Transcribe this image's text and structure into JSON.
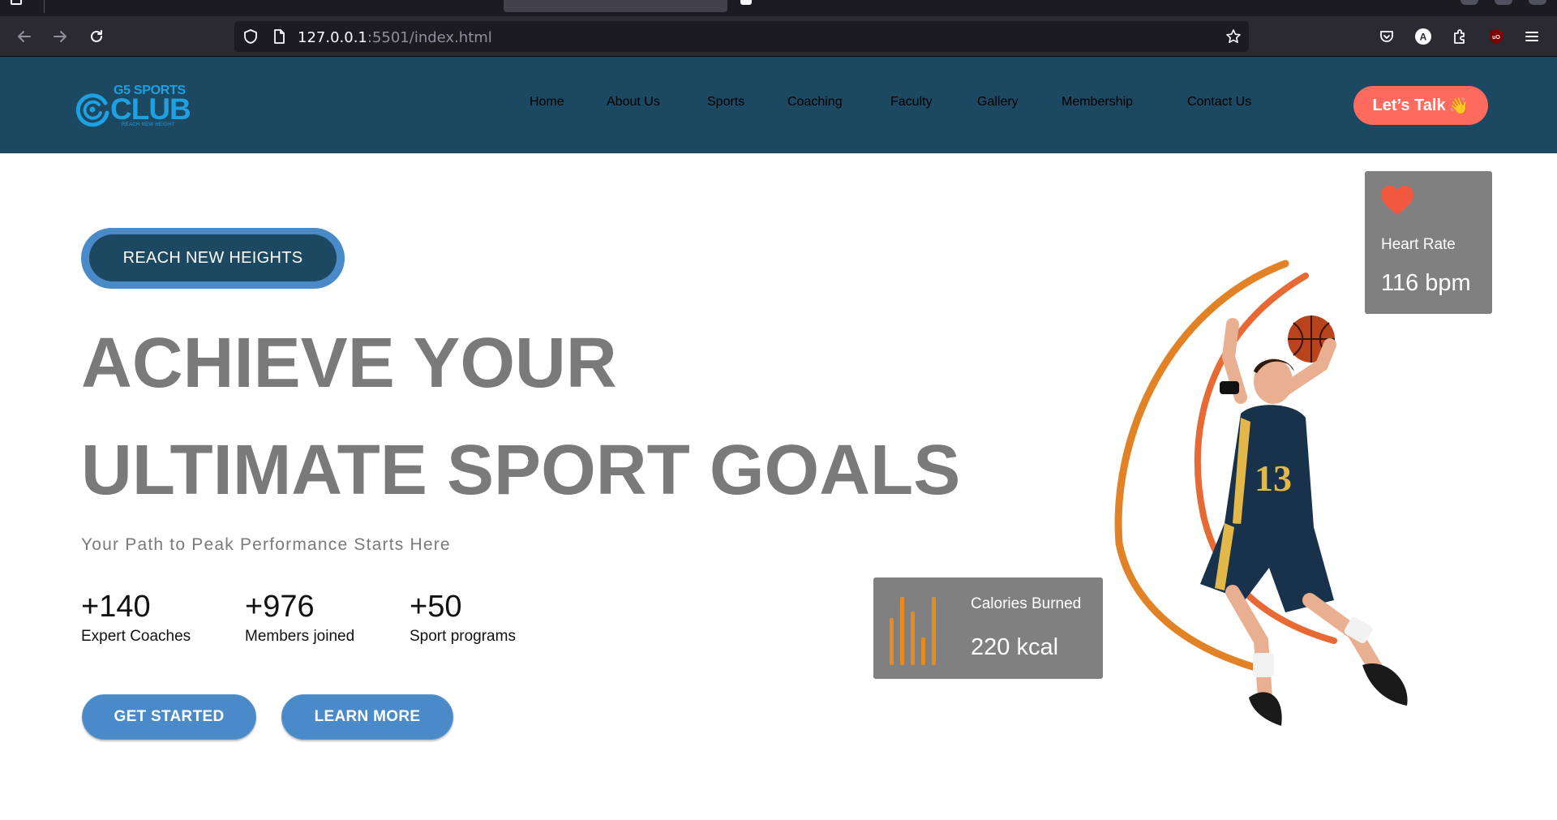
{
  "browser": {
    "url_host": "127.0.0.1",
    "url_path": ":5501/index.html"
  },
  "site": {
    "logo": {
      "top_text": "G5 SPORTS",
      "main_text": "CLUB",
      "tagline": "REACH NEW HEIGHT"
    },
    "nav": [
      "Home",
      "About Us",
      "Sports",
      "Coaching",
      "Faculty",
      "Gallery",
      "Membership",
      "Contact Us"
    ],
    "cta_label": "Let’s Talk",
    "cta_emoji": "👋"
  },
  "hero": {
    "pill_label": "REACH NEW HEIGHTS",
    "heading_line1": "ACHIEVE YOUR",
    "heading_line2": "ULTIMATE SPORT GOALS",
    "subtitle": "Your Path to Peak Performance Starts Here",
    "stats": [
      {
        "value": "+140",
        "label": "Expert Coaches"
      },
      {
        "value": "+976",
        "label": "Members joined"
      },
      {
        "value": "+50",
        "label": "Sport programs"
      }
    ],
    "buttons": {
      "primary": "GET STARTED",
      "secondary": "LEARN MORE"
    }
  },
  "cards": {
    "calories": {
      "title": "Calories Burned",
      "value": "220 kcal"
    },
    "heart": {
      "title": "Heart Rate",
      "value": "116 bpm"
    }
  },
  "colors": {
    "header_bg": "#1d4861",
    "accent_blue": "#4a8ac8",
    "cta_coral": "#fe6a5e",
    "logo_blue": "#1fa0e0",
    "card_gray": "#808080"
  }
}
